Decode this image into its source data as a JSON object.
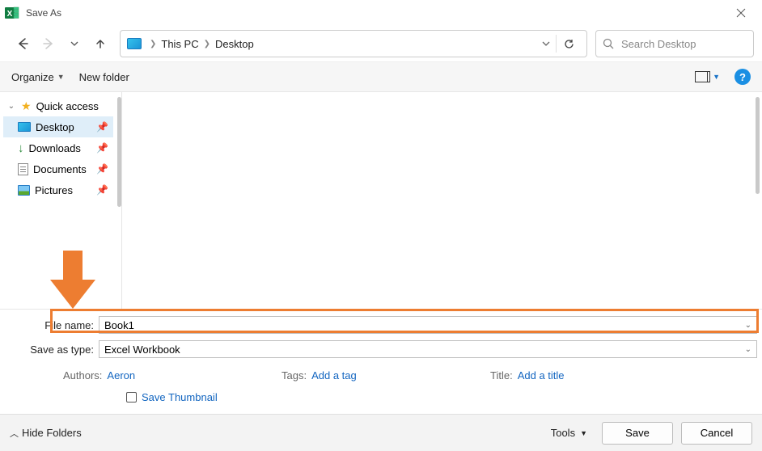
{
  "title": "Save As",
  "breadcrumb": {
    "root": "This PC",
    "current": "Desktop"
  },
  "search": {
    "placeholder": "Search Desktop"
  },
  "toolbar": {
    "organize": "Organize",
    "new_folder": "New folder"
  },
  "sidebar": {
    "quick_access": "Quick access",
    "items": [
      {
        "label": "Desktop"
      },
      {
        "label": "Downloads"
      },
      {
        "label": "Documents"
      },
      {
        "label": "Pictures"
      }
    ]
  },
  "form": {
    "filename_label": "File name:",
    "filename_value": "Book1",
    "type_label": "Save as type:",
    "type_value": "Excel Workbook"
  },
  "meta": {
    "authors_label": "Authors:",
    "authors_value": "Aeron",
    "tags_label": "Tags:",
    "tags_prompt": "Add a tag",
    "title_label": "Title:",
    "title_prompt": "Add a title",
    "thumbnail_label": "Save Thumbnail"
  },
  "bottom": {
    "hide": "Hide Folders",
    "tools": "Tools",
    "save": "Save",
    "cancel": "Cancel"
  }
}
